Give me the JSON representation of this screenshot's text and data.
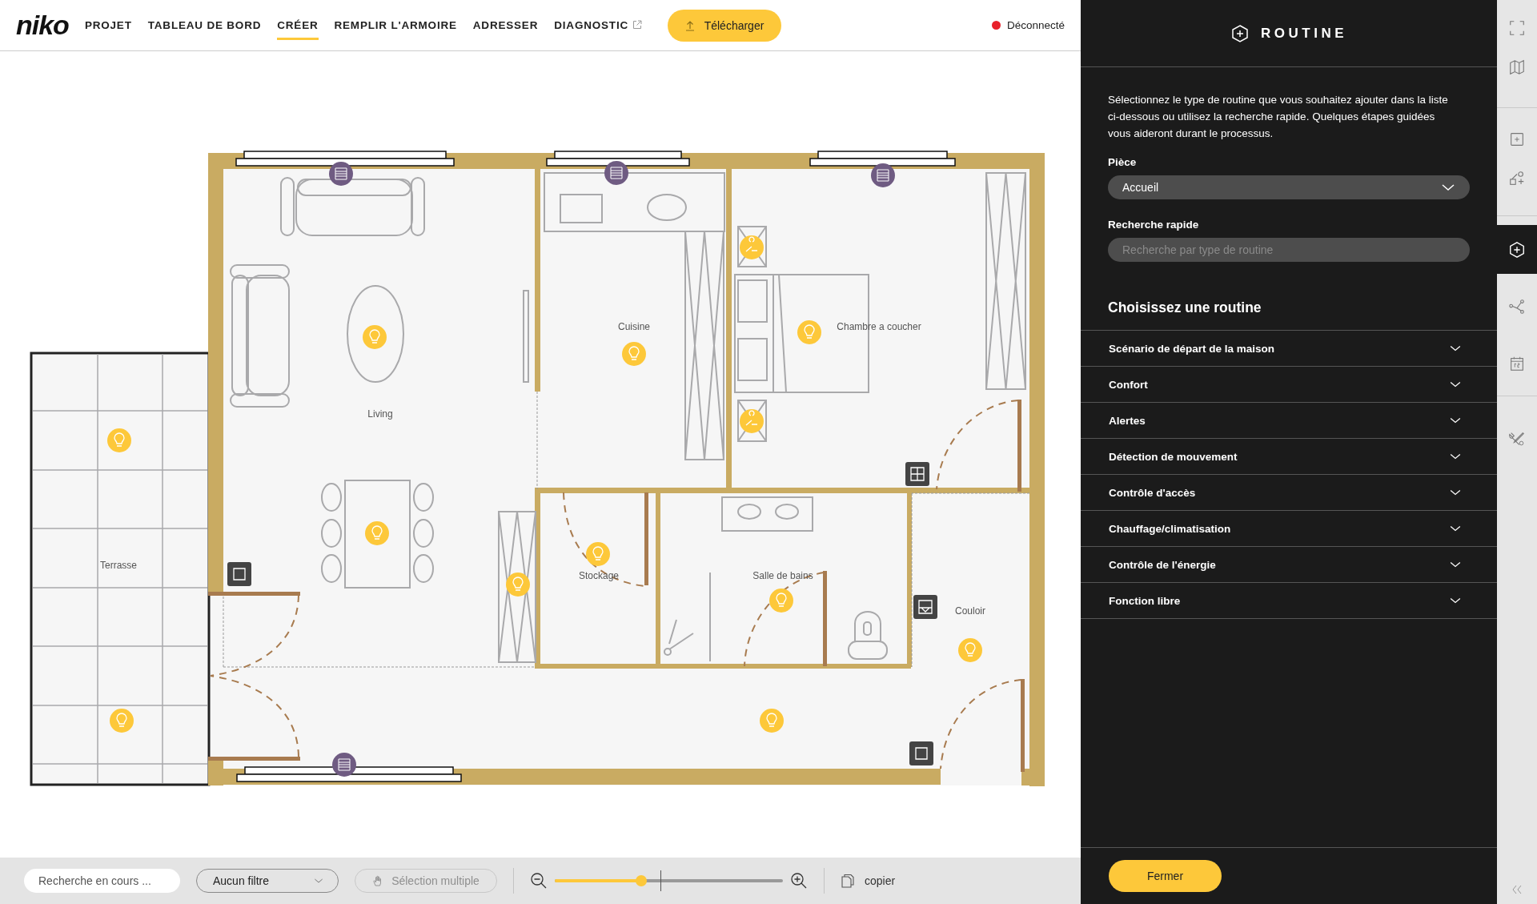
{
  "nav": {
    "logo": "niko",
    "items": [
      {
        "label": "PROJET",
        "selected": false,
        "external": false
      },
      {
        "label": "TABLEAU DE BORD",
        "selected": false,
        "external": false
      },
      {
        "label": "CRÉER",
        "selected": true,
        "external": false
      },
      {
        "label": "REMPLIR L'ARMOIRE",
        "selected": false,
        "external": false
      },
      {
        "label": "ADRESSER",
        "selected": false,
        "external": false
      },
      {
        "label": "DIAGNOSTIC",
        "selected": false,
        "external": true
      }
    ],
    "upload_button": {
      "label": "Télécharger"
    },
    "status": {
      "label": "Déconnecté",
      "connected": false
    }
  },
  "floor_plan": {
    "rooms": [
      {
        "name": "Living"
      },
      {
        "name": "Cuisine"
      },
      {
        "name": "Chambre a coucher"
      },
      {
        "name": "Terrasse"
      },
      {
        "name": "Stockage"
      },
      {
        "name": "Salle de bains"
      },
      {
        "name": "Couloir"
      }
    ]
  },
  "bottom_bar": {
    "search": {
      "placeholder": "Recherche en cours ..."
    },
    "filter": {
      "value": "Aucun filtre"
    },
    "multi_select": {
      "label": "Sélection multiple",
      "disabled": true
    },
    "zoom": {
      "level": 0.38
    },
    "copy": {
      "label": "copier"
    }
  },
  "panel": {
    "title": "ROUTINE",
    "description": "Sélectionnez le type de routine que vous souhaitez ajouter dans la liste ci-dessous ou utilisez la recherche rapide. Quelques étapes guidées vous aideront durant le processus.",
    "room_label": "Pièce",
    "room_value": "Accueil",
    "search_label": "Recherche rapide",
    "search_placeholder": "Recherche par type de routine",
    "list_title": "Choisissez une routine",
    "categories": [
      {
        "label": "Scénario de départ de la maison",
        "expanded": false
      },
      {
        "label": "Confort",
        "expanded": false
      },
      {
        "label": "Alertes",
        "expanded": false
      },
      {
        "label": "Détection de mouvement",
        "expanded": false
      },
      {
        "label": "Contrôle d'accès",
        "expanded": false
      },
      {
        "label": "Chauffage/climatisation",
        "expanded": false
      },
      {
        "label": "Contrôle de l'énergie",
        "expanded": false
      },
      {
        "label": "Fonction libre",
        "expanded": false
      }
    ],
    "close_button": "Fermer"
  },
  "toolbar": {
    "items": [
      {
        "kind": "fullscreen",
        "selected": false
      },
      {
        "kind": "map",
        "selected": false
      },
      {
        "kind": "add",
        "selected": false
      },
      {
        "kind": "shapes",
        "selected": false
      },
      {
        "kind": "routine",
        "selected": true
      },
      {
        "kind": "connections",
        "selected": false
      },
      {
        "kind": "calendar",
        "selected": false
      },
      {
        "kind": "tools",
        "selected": false
      }
    ]
  }
}
